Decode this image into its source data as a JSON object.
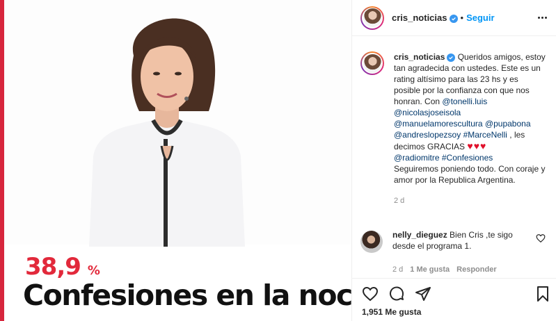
{
  "post": {
    "stat_value": "38,9",
    "stat_unit": "%",
    "headline": "Confesiones en la noche"
  },
  "header": {
    "username": "cris_noticias",
    "separator": "•",
    "follow_label": "Seguir"
  },
  "caption": {
    "username": "cris_noticias",
    "text_1": "Queridos amigos, estoy tan agradecida con ustedes. Este es un rating altísimo para las 23 hs y es posible por la confianza con que nos honran. Con ",
    "mention_tonelli": "@tonelli.luis",
    "mention_nicolas": "@nicolasjoseisola",
    "mention_manuel": "@manuelamorescultura",
    "mention_pupa": "@pupabona",
    "mention_andres": "@andreslopezsoy",
    "hashtag_marce": "#MarceNelli",
    "text_2": " , les decimos GRACIAS ",
    "hearts": "♥♥♥",
    "mention_radio": "@radiomitre",
    "hashtag_confesiones": "#Confesiones",
    "text_3": "Seguiremos poniendo todo. Con coraje y amor por la Republica Argentina.",
    "time": "2 d"
  },
  "comment": {
    "username": "nelly_dieguez",
    "text": "Bien Cris ,te sigo desde el programa 1.",
    "time": "2 d",
    "likes": "1 Me gusta",
    "reply": "Responder"
  },
  "actions": {
    "likes": "1,951 Me gusta"
  },
  "colors": {
    "accent_red": "#e2293b",
    "link": "#00376b",
    "follow_blue": "#0095f6",
    "verified_blue": "#3897f0"
  },
  "icons": [
    "more-icon",
    "verified-icon",
    "heart-icon",
    "comment-icon",
    "share-icon",
    "bookmark-icon"
  ]
}
